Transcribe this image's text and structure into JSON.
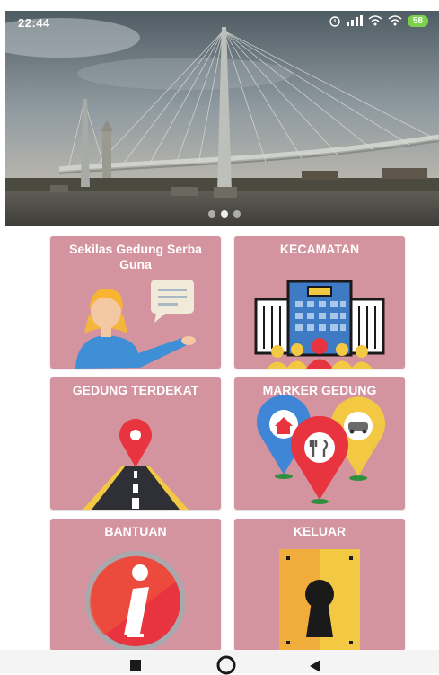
{
  "status_bar": {
    "time": "22:44",
    "battery": "58"
  },
  "carousel": {
    "slide_count": 3,
    "active_index": 1
  },
  "menu": {
    "items": [
      {
        "label": "Sekilas Gedung Serba Guna",
        "icon": "guide-person-icon"
      },
      {
        "label": "KECAMATAN",
        "icon": "district-building-icon"
      },
      {
        "label": "GEDUNG TERDEKAT",
        "icon": "nearest-road-pin-icon"
      },
      {
        "label": "MARKER GEDUNG",
        "icon": "building-markers-icon"
      },
      {
        "label": "BANTUAN",
        "icon": "info-icon"
      },
      {
        "label": "KELUAR",
        "icon": "keyhole-door-icon"
      }
    ]
  },
  "colors": {
    "tile": "#d4949f",
    "tile_label": "#ffffff"
  },
  "nav": {
    "icons": [
      "recents-square-icon",
      "home-circle-icon",
      "back-triangle-icon"
    ]
  }
}
